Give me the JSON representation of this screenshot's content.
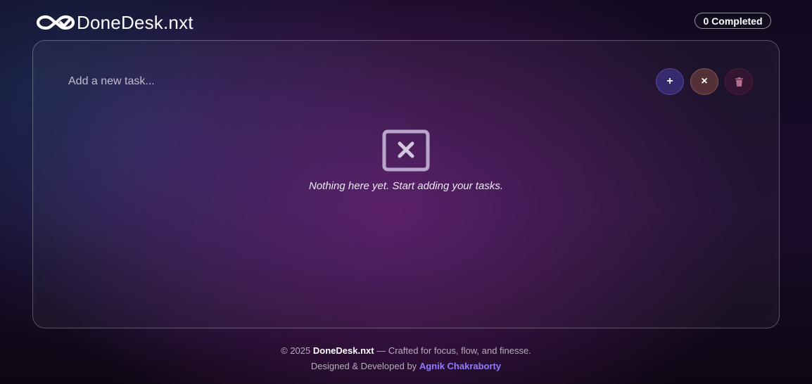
{
  "header": {
    "logo_text": "DoneDesk.nxt",
    "completed_badge": "0 Completed"
  },
  "task_input": {
    "placeholder": "Add a new task...",
    "value": ""
  },
  "actions": {
    "add_label": "+",
    "clear_label": "×"
  },
  "empty_state": {
    "message": "Nothing here yet. Start adding your tasks."
  },
  "footer": {
    "copyright_prefix": "© 2025",
    "brand": "DoneDesk.nxt",
    "tagline": "— Crafted for focus, flow, and finesse.",
    "credit_prefix": "Designed & Developed by",
    "author": "Agnik Chakraborty"
  },
  "colors": {
    "accent_purple": "#8f7cff",
    "add_button": "#3c3282",
    "clear_button": "#5c343a",
    "delete_button": "#461637"
  }
}
